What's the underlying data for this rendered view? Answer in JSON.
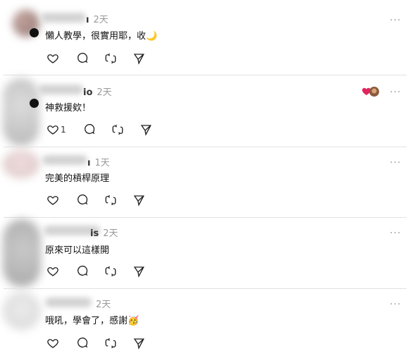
{
  "comments": [
    {
      "name_suffix": "ı",
      "time": "2天",
      "text": "懶人教學，很實用耶，收🌙",
      "like_count": ""
    },
    {
      "name_suffix": "io",
      "time": "2天",
      "text": "神救援欸！",
      "like_count": "1"
    },
    {
      "name_suffix": "ı",
      "time": "1天",
      "text": "完美的槓桿原理",
      "like_count": ""
    },
    {
      "name_suffix": "is",
      "time": "2天",
      "text": "原來可以這樣開",
      "like_count": ""
    },
    {
      "name_suffix": "",
      "time": "2天",
      "text": "哦吼，學會了，感謝🥳",
      "like_count": ""
    }
  ],
  "more_label": "···",
  "icons": {
    "like": "heart-icon",
    "reply": "comment-icon",
    "repost": "repost-icon",
    "share": "send-icon",
    "more": "more-icon"
  },
  "colors": {
    "divider": "#e2e2e2",
    "muted": "#9a9a9a",
    "heart_liked": "#e0245e"
  }
}
